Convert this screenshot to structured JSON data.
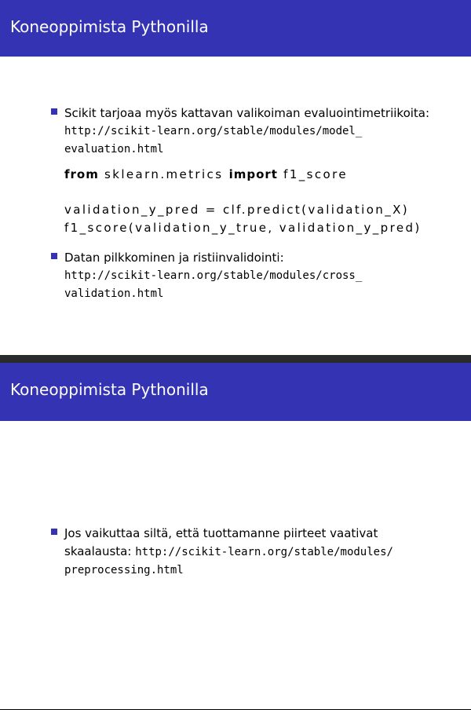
{
  "slides": [
    {
      "title": "Koneoppimista Pythonilla",
      "items": [
        {
          "text": "Scikit tarjoaa myös kattavan valikoiman evaluointimetriikoita:",
          "url_line1": "http://scikit-learn.org/stable/modules/model_",
          "url_line2": "evaluation.html"
        },
        {
          "text": "Datan pilkkominen ja ristiinvalidointi:",
          "url_line1": "http://scikit-learn.org/stable/modules/cross_",
          "url_line2": "validation.html"
        }
      ],
      "code": {
        "kw_from": "from",
        "module": "sklearn.metrics",
        "kw_import": "import",
        "name": "f1_score",
        "line2": "validation_y_pred = clf.predict(validation_X)",
        "line3": "f1_score(validation_y_true, validation_y_pred)"
      }
    },
    {
      "title": "Koneoppimista Pythonilla",
      "items": [
        {
          "text_line1": "Jos vaikuttaa siltä, että tuottamanne piirteet vaativat",
          "text_line2": "skaalausta:",
          "url_line1": "http://scikit-learn.org/stable/modules/",
          "url_line2": "preprocessing.html"
        }
      ]
    }
  ]
}
